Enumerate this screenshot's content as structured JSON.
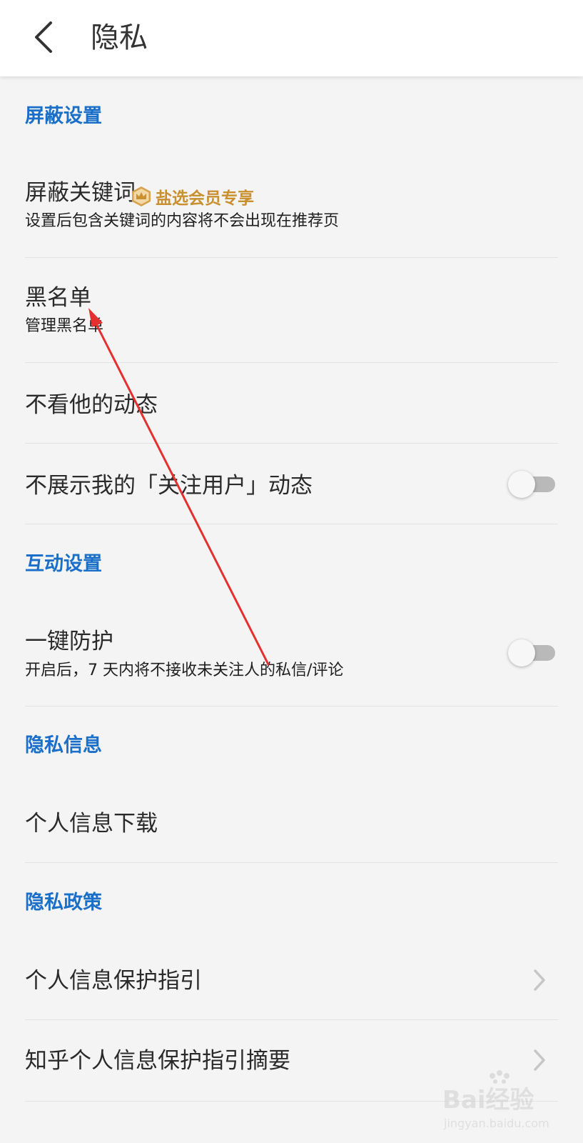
{
  "header": {
    "title": "隐私"
  },
  "sections": {
    "block": {
      "title": "屏蔽设置"
    },
    "interact": {
      "title": "互动设置"
    },
    "info": {
      "title": "隐私信息"
    },
    "policy": {
      "title": "隐私政策"
    }
  },
  "items": {
    "keywords": {
      "title": "屏蔽关键词",
      "badge": "盐选会员专享",
      "subtitle": "设置后包含关键词的内容将不会出现在推荐页"
    },
    "blacklist": {
      "title": "黑名单",
      "subtitle": "管理黑名单"
    },
    "hide_feeds": {
      "title": "不看他的动态"
    },
    "hide_following": {
      "title": "不展示我的「关注用户」动态",
      "toggle": false
    },
    "protection": {
      "title": "一键防护",
      "subtitle": "开启后，7 天内将不接收未关注人的私信/评论",
      "toggle": false
    },
    "download": {
      "title": "个人信息下载"
    },
    "guide": {
      "title": "个人信息保护指引"
    },
    "guide_summary": {
      "title": "知乎个人信息保护指引摘要"
    }
  },
  "watermark": {
    "text": "Bai经验",
    "url": "jingyan.baidu.com"
  },
  "colors": {
    "section_title": "#1a6fc9",
    "vip_badge": "#c9902f",
    "annotation_arrow": "#e53030",
    "toggle_off": "#b9b9b9"
  },
  "icons": {
    "back": "chevron-left-icon",
    "vip": "crown-hexagon-icon",
    "more": "chevron-right-icon"
  }
}
